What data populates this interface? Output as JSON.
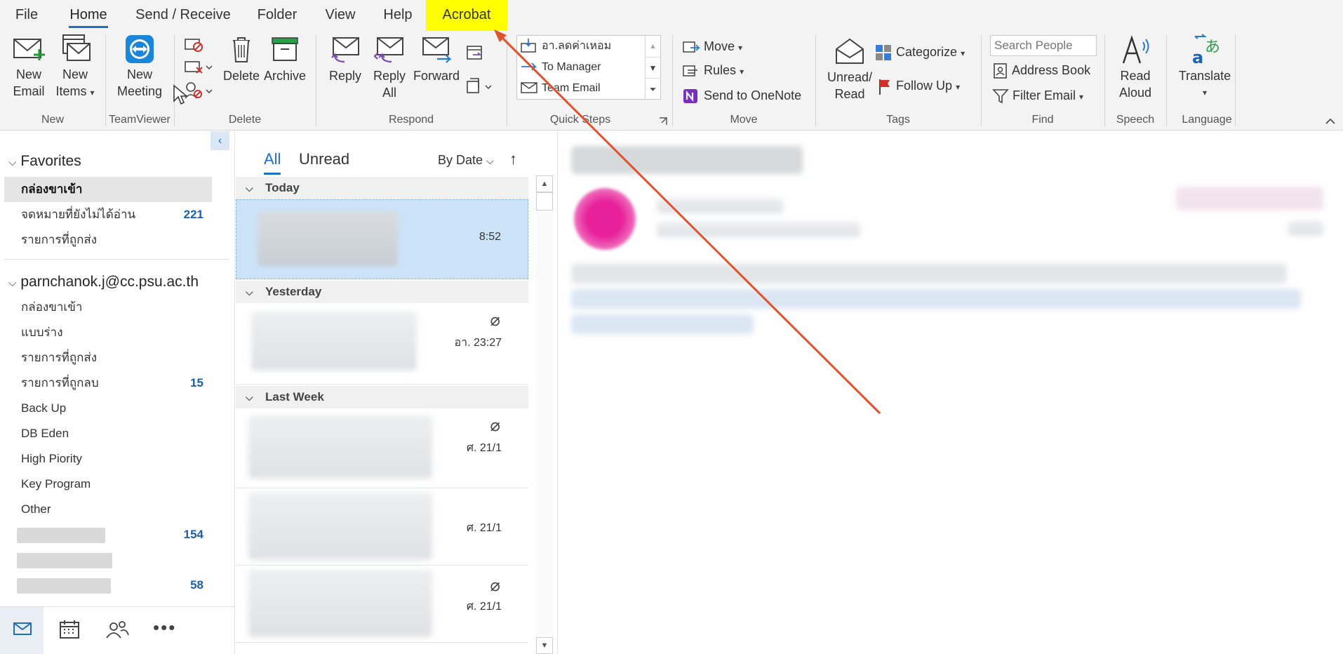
{
  "tabs": [
    {
      "label": "File"
    },
    {
      "label": "Home"
    },
    {
      "label": "Send / Receive"
    },
    {
      "label": "Folder"
    },
    {
      "label": "View"
    },
    {
      "label": "Help"
    },
    {
      "label": "Acrobat"
    }
  ],
  "ribbon": {
    "new_email": "New\nEmail",
    "new_items": "New\nItems",
    "group_new": "New",
    "new_meeting": "New\nMeeting",
    "group_teamviewer": "TeamViewer",
    "delete": "Delete",
    "archive": "Archive",
    "group_delete": "Delete",
    "reply": "Reply",
    "reply_all": "Reply\nAll",
    "forward": "Forward",
    "group_respond": "Respond",
    "quick_steps": [
      "อา.ลดค่าเหอม",
      "To Manager",
      "Team Email"
    ],
    "group_quick_steps": "Quick Steps",
    "move": "Move",
    "rules": "Rules",
    "send_onenote": "Send to OneNote",
    "group_move": "Move",
    "unread_read": "Unread/\nRead",
    "categorize": "Categorize",
    "follow_up": "Follow Up",
    "group_tags": "Tags",
    "search_people_placeholder": "Search People",
    "address_book": "Address Book",
    "filter_email": "Filter Email",
    "group_find": "Find",
    "read_aloud": "Read\nAloud",
    "group_speech": "Speech",
    "translate": "Translate",
    "group_language": "Language"
  },
  "folders": {
    "favorites_header": "Favorites",
    "favorites": [
      {
        "label": "กล่องขาเข้า",
        "count": ""
      },
      {
        "label": "จดหมายที่ยังไม่ได้อ่าน",
        "count": "221"
      },
      {
        "label": "รายการที่ถูกส่ง",
        "count": ""
      }
    ],
    "account_header": "parnchanok.j@cc.psu.ac.th",
    "account_folders": [
      {
        "label": "กล่องขาเข้า",
        "count": ""
      },
      {
        "label": "แบบร่าง",
        "count": ""
      },
      {
        "label": "รายการที่ถูกส่ง",
        "count": ""
      },
      {
        "label": "รายการที่ถูกลบ",
        "count": "15"
      },
      {
        "label": "Back Up",
        "count": ""
      },
      {
        "label": "DB Eden",
        "count": ""
      },
      {
        "label": "High Piority",
        "count": ""
      },
      {
        "label": "Key Program",
        "count": ""
      },
      {
        "label": "Other",
        "count": ""
      }
    ],
    "hidden_counts": [
      "154",
      "",
      "58"
    ]
  },
  "message_list": {
    "tab_all": "All",
    "tab_unread": "Unread",
    "sort": "By Date",
    "groups": [
      "Today",
      "Yesterday",
      "Last Week"
    ],
    "times": [
      "8:52",
      "อา. 23:27",
      "ศ. 21/1",
      "ศ. 21/1",
      "ศ. 21/1"
    ]
  },
  "colors": {
    "accent": "#1d6fc2",
    "highlight": "#ffff00",
    "annotation_arrow": "#e0522e",
    "count_blue": "#1b5fb0",
    "selected_row": "#cce3f7"
  }
}
